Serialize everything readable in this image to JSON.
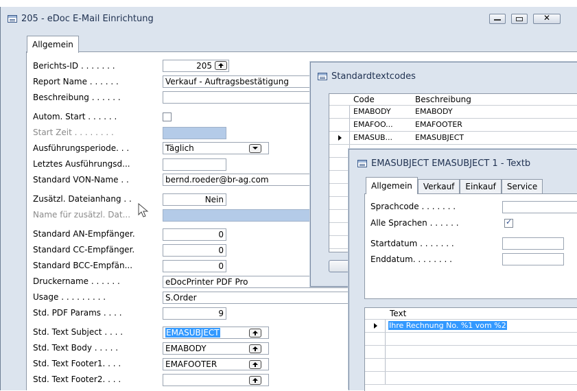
{
  "main_window": {
    "title": "205 - eDoc E-Mail Einrichtung",
    "tab_general": "Allgemein",
    "fields": [
      {
        "label": "Berichts-ID . . . . . . .",
        "value": "205"
      },
      {
        "label": "Report Name . . . . . .",
        "value": "Verkauf - Auftragsbestätigung"
      },
      {
        "label": "Beschreibung . . . . . .",
        "value": ""
      },
      {
        "label": "Autom. Start . . . . . .",
        "value": ""
      },
      {
        "label": "Start Zeit . . . . . . . .",
        "value": ""
      },
      {
        "label": "Ausführungsperiode. . .",
        "value": "Täglich"
      },
      {
        "label": "Letztes Ausführungsd...",
        "value": ""
      },
      {
        "label": "Standard VON-Name . .",
        "value": "bernd.roeder@br-ag.com"
      },
      {
        "label": "Zusätzl. Dateianhang . .",
        "value": "Nein"
      },
      {
        "label": "Name für zusätzl. Dat...",
        "value": ""
      },
      {
        "label": "Standard AN-Empfänger.",
        "value": "0"
      },
      {
        "label": "Standard CC-Empfänger.",
        "value": "0"
      },
      {
        "label": "Standard BCC-Empfän...",
        "value": "0"
      },
      {
        "label": "Druckername . . . . . .",
        "value": "eDocPrinter PDF Pro"
      },
      {
        "label": "Usage . . . . . . . . .",
        "value": "S.Order"
      },
      {
        "label": "Std. PDF Params . . . .",
        "value": "9"
      },
      {
        "label": "Std. Text Subject . . . .",
        "value": "EMASUBJECT"
      },
      {
        "label": "Std. Text Body . . . . .",
        "value": "EMABODY"
      },
      {
        "label": "Std. Text Footer1. . . .",
        "value": "EMAFOOTER"
      },
      {
        "label": "Std. Text Footer2. . . .",
        "value": ""
      }
    ]
  },
  "std_text_window": {
    "title": "Standardtextcodes",
    "col_code": "Code",
    "col_desc": "Beschreibung",
    "rows": [
      {
        "code": "EMABODY",
        "desc": "EMABODY"
      },
      {
        "code": "EMAFOO...",
        "desc": "EMAFOOTER"
      },
      {
        "code": "EMASUB...",
        "desc": "EMASUBJECT"
      }
    ]
  },
  "text_window": {
    "title": "EMASUBJECT EMASUBJECT 1 - Textb",
    "tabs": [
      "Allgemein",
      "Verkauf",
      "Einkauf",
      "Service"
    ],
    "fields": [
      {
        "label": "Sprachcode . . . . . . .",
        "value": ""
      },
      {
        "label": "Alle Sprachen . . . . . .",
        "value": ""
      },
      {
        "label": "Startdatum . . . . . . .",
        "value": ""
      },
      {
        "label": "Enddatum. . . . . . . .",
        "value": ""
      }
    ],
    "col_text": "Text",
    "text_rows": [
      "Ihre Rechnung No. %1 vom %2"
    ]
  },
  "colors": {
    "selection": "#3399ff",
    "disabled_field": "#b4cbe8",
    "frame": "#dce4ee"
  }
}
